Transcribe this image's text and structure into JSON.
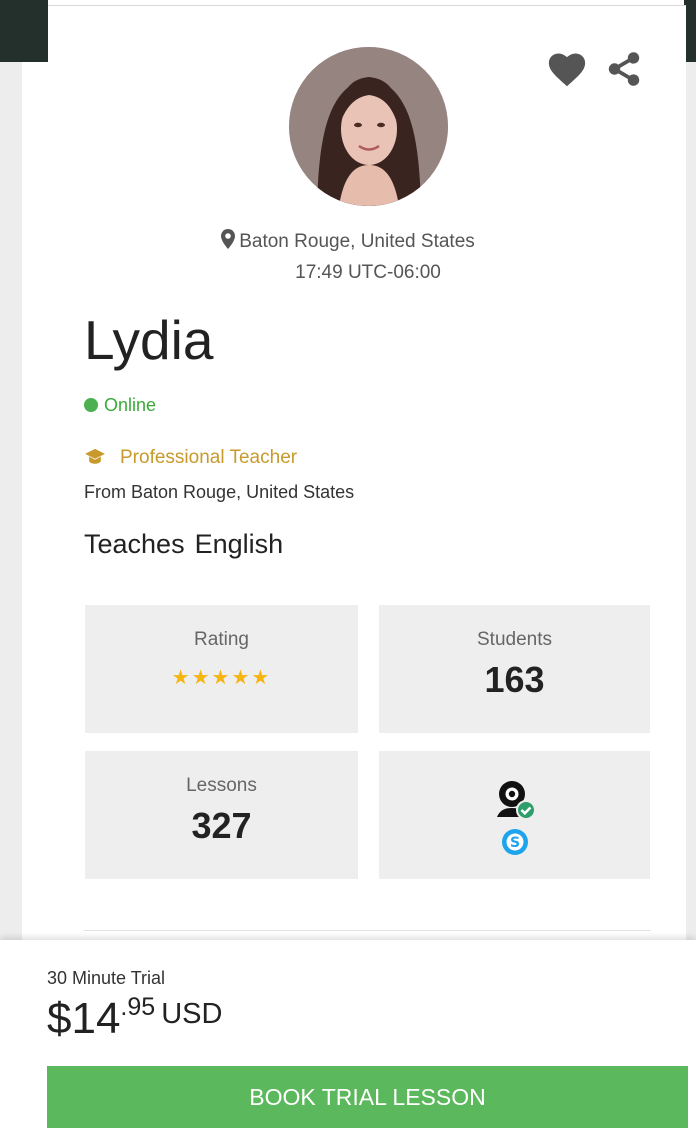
{
  "profile": {
    "location": "Baton Rouge, United States",
    "local_time": "17:49 UTC-06:00",
    "name": "Lydia",
    "status": "Online",
    "teacher_type": "Professional Teacher",
    "from": "From Baton Rouge, United States",
    "teaches_label": "Teaches",
    "teaches_language": "English"
  },
  "stats": {
    "rating_label": "Rating",
    "rating_stars": "★★★★★",
    "rating_value": 5,
    "students_label": "Students",
    "students_value": "163",
    "lessons_label": "Lessons",
    "lessons_value": "327"
  },
  "icons": {
    "favorite": "heart-icon",
    "share": "share-icon",
    "location": "map-pin-icon",
    "teacher": "graduation-cap-icon",
    "webcam": "webcam-verified-icon",
    "skype": "skype-icon"
  },
  "booking": {
    "trial_label": "30 Minute Trial",
    "price_main": "$14",
    "price_cents": ".95",
    "currency": "USD",
    "button_label": "BOOK TRIAL LESSON"
  },
  "colors": {
    "online": "#4caf50",
    "teacher_badge": "#c89a2c",
    "stars": "#f6b40e",
    "book_button": "#5cb85c"
  }
}
